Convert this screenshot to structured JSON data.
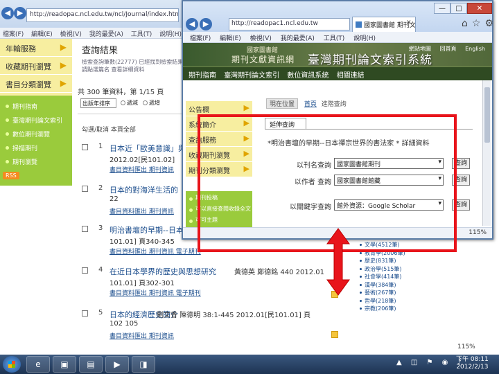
{
  "bg": {
    "address": "http://readopac.ncl.edu.tw/ncl/Journal/index.htm",
    "menu": [
      "檔案(F)",
      "編輯(E)",
      "檢視(V)",
      "我的最愛(A)",
      "工具(T)",
      "說明(H)"
    ],
    "sidebar": [
      "年輪服務",
      "收藏期刊瀏覽",
      "書目分類瀏覽"
    ],
    "green_items": [
      "期刊指南",
      "臺灣期刊論文索引",
      "數位期刊瀏覽",
      "掃描期刊",
      "期刊瀏覽"
    ],
    "rss_label": "RSS",
    "result_head": "查詢結果",
    "note": "檢索查詢筆數(22777) 已經找到檢索結果 請點選篇名 查看詳細資料",
    "count_text": "共 300 筆資料，第 1/15 頁",
    "sort_value": "出版年排序",
    "radio_desc": "遞減",
    "radio_asc": "遞增",
    "check_head": "勾選/取消 本頁全部",
    "rows": [
      {
        "num": "1",
        "title": "日本近「歐美意識」與「",
        "meta": "2012.02[民101.02]",
        "links": "書目資料匯出  期刊資訊",
        "extra": "頁"
      },
      {
        "num": "2",
        "title": "日本的對海洋生活的",
        "meta": "22",
        "links": "書目資料匯出  期刊資訊"
      },
      {
        "num": "3",
        "title": "明治書壇的早期--日本禪",
        "meta": "101.01]  頁340-345",
        "links": "書目資料匯出  期刊資訊  電子期刊"
      },
      {
        "num": "4",
        "title": "在近日本學界的歷史與思想研究",
        "meta": "101.01]  頁302-301",
        "links": "書目資料匯出  期刊資訊  電子期刊",
        "extra": "黃德英  鄭德銘  440 2012.01"
      },
      {
        "num": "5",
        "title": "日本的經濟歷史簡介",
        "meta": "102 105",
        "links": "書目資料匯出  期刊資訊",
        "extra": "劉文香  陳德明  38:1-445 2012.01[民101.01]  頁"
      }
    ],
    "right_list": [
      "文學(4512筆)",
      "教育學(2006筆)",
      "歷史(831筆)",
      "政治學(515筆)",
      "社會學(414筆)",
      "漢學(384筆)",
      "藝術(267筆)",
      "哲學(218筆)",
      "宗教(206筆)"
    ],
    "zoom": "115%"
  },
  "fg": {
    "address": "http://readopac1.ncl.edu.tw",
    "tab_label": "國家圖書館 期刊文獻",
    "win_controls": [
      "—",
      "□",
      "✕"
    ],
    "menu": [
      "檔案(F)",
      "編輯(E)",
      "檢視(V)",
      "我的最愛(A)",
      "工具(T)",
      "說明(H)"
    ],
    "banner": {
      "library": "國家圖書館",
      "site": "期刊文獻資訊網",
      "big_title": "臺灣期刊論文索引系統",
      "top_links": [
        "網站地圖",
        "回首頁",
        "English"
      ]
    },
    "nav": [
      "期刊指南",
      "臺灣期刊論文索引",
      "數位資訊系統",
      "相關連結"
    ],
    "leftbar": [
      "公告欄",
      "系統簡介",
      "查詢服務",
      "收藏期刊瀏覽",
      "期刊分類瀏覽"
    ],
    "green_items": [
      "期刊投稿",
      "可以直接查閱收錄全文",
      "可可主題"
    ],
    "crumb_tag": "現在位置",
    "crumb_home": "首頁",
    "crumb_current": "進階查詢",
    "subtab": "延伸查詢",
    "query_text": "*明治書壇的早期--日本禪宗世界的書法家 * 詳細資料",
    "fields": [
      {
        "label": "以刊名查詢",
        "value": "國家圖書館期刊",
        "button": "查詢"
      },
      {
        "label": "以作者 查詢",
        "value": "國家圖書館館藏",
        "button": "查詢"
      },
      {
        "label": "以關鍵字查詢",
        "value": "館外資源：Google Scholar",
        "button": "查詢"
      }
    ],
    "status_zoom": "115%"
  },
  "taskbar": {
    "items": [
      "e",
      "▣",
      "▤",
      "▶",
      "◨"
    ],
    "tray": "▲ ◫ ⚑ ◉ ♪",
    "time": "下午 08:11",
    "date": "2012/2/13"
  },
  "colors": {
    "highlight_rect": "#e8141b",
    "arrow": "#e8141b"
  }
}
